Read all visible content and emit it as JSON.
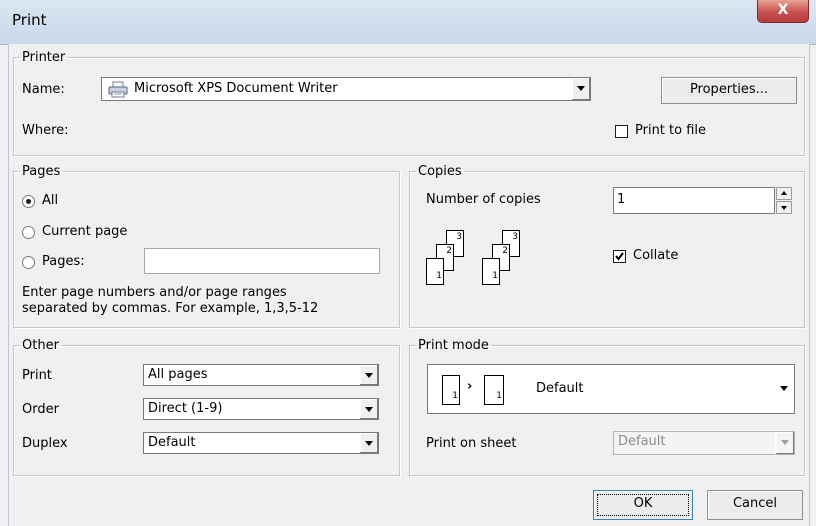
{
  "window": {
    "title": "Print",
    "close_label": "X"
  },
  "printer": {
    "legend": "Printer",
    "name_label": "Name:",
    "name_value": "Microsoft XPS Document Writer",
    "icon": "printer-icon",
    "properties_label": "Properties...",
    "where_label": "Where:",
    "print_to_file_label": "Print to file",
    "print_to_file_checked": false
  },
  "pages": {
    "legend": "Pages",
    "all_label": "All",
    "current_label": "Current page",
    "pages_label": "Pages:",
    "pages_value": "",
    "selected": "All",
    "hint_line1": "Enter page numbers and/or page ranges",
    "hint_line2": "separated by commas. For example, 1,3,5-12"
  },
  "copies": {
    "legend": "Copies",
    "number_label": "Number of copies",
    "number_value": "1",
    "collate_label": "Collate",
    "collate_checked": true,
    "page_numbers": [
      "1",
      "2",
      "3"
    ]
  },
  "other": {
    "legend": "Other",
    "print_label": "Print",
    "print_value": "All pages",
    "order_label": "Order",
    "order_value": "Direct (1-9)",
    "duplex_label": "Duplex",
    "duplex_value": "Default"
  },
  "print_mode": {
    "legend": "Print mode",
    "mode_value": "Default",
    "mode_pages": [
      "1",
      "1"
    ],
    "print_on_sheet_label": "Print on sheet",
    "print_on_sheet_value": "Default"
  },
  "buttons": {
    "ok_label": "OK",
    "cancel_label": "Cancel"
  }
}
